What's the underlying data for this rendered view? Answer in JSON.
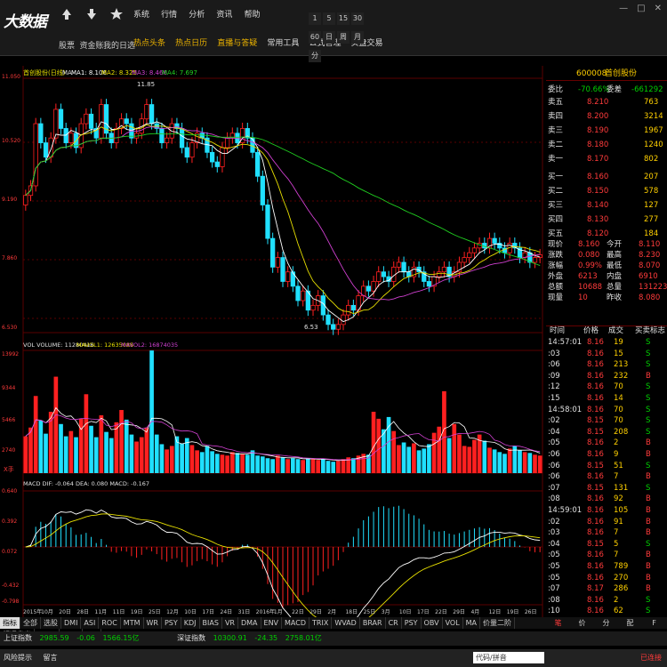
{
  "app": {
    "logo": "大数据"
  },
  "toolbar": [
    {
      "label": "股票",
      "icon": "arrow-up-icon"
    },
    {
      "label": "资金账",
      "icon": "download-icon"
    },
    {
      "label": "我的日选",
      "icon": "star-icon"
    }
  ],
  "menu": [
    "系统",
    "行情",
    "分析",
    "资讯",
    "帮助"
  ],
  "links": [
    "热点头条",
    "热点日历",
    "直播与答疑",
    "常用工具",
    "公式管理",
    "实盘交易"
  ],
  "periods": [
    "1",
    "5",
    "15",
    "30",
    "60",
    "日",
    "周",
    "月",
    "分"
  ],
  "chart": {
    "title": "首创股份(日线)",
    "ma_legend": [
      "MA1: 8.106",
      "MA2: 8.325",
      "MA3: 8.466",
      "MA4: 7.697"
    ],
    "ma_label": "MA",
    "price_ticks": [
      "11.050",
      "10.520",
      "9.190",
      "7.860",
      "6.530"
    ],
    "max_label": "11.85",
    "min_label": "6.53",
    "vol_legend": [
      "VOL VOLUME: 11280416",
      "MAVOL1: 12635088",
      "MAVOL2: 16874035"
    ],
    "vol_ticks": [
      "13992",
      "9344",
      "5466",
      "2740"
    ],
    "vol_unit": "X手",
    "macd_legend": "MACD DIF: -0.064  DEA: 0.080  MACD: -0.167",
    "macd_ticks": [
      "0.640",
      "0.392",
      "0.072",
      "-0.432",
      "-0.798"
    ],
    "dates": [
      "2015年",
      "10月",
      "20日",
      "28日",
      "11月",
      "11日",
      "19日",
      "25日",
      "12月",
      "10日",
      "17日",
      "24日",
      "31日",
      "2016年",
      "1月",
      "22日",
      "29日",
      "2月",
      "18日",
      "25日",
      "3月",
      "10日",
      "17日",
      "22日",
      "29日",
      "4月",
      "12日",
      "19日",
      "26日"
    ],
    "colors": {
      "up": "#ff2020",
      "down": "#20e0ff",
      "ma1": "#ffffff",
      "ma2": "#e8e000",
      "ma3": "#d040d0",
      "ma4": "#20d020"
    }
  },
  "chart_data": {
    "type": "candlestick",
    "ylim": [
      6.53,
      11.85
    ],
    "close": [
      9.4,
      9.6,
      10.9,
      10.5,
      10.2,
      10.6,
      11.2,
      10.8,
      10.5,
      10.7,
      10.4,
      10.9,
      11.1,
      10.8,
      10.6,
      11.3,
      10.7,
      10.5,
      10.8,
      11.0,
      10.9,
      10.6,
      10.7,
      11.0,
      11.3,
      10.9,
      10.8,
      10.5,
      10.6,
      10.9,
      10.8,
      10.4,
      10.2,
      10.5,
      10.7,
      10.6,
      10.3,
      10.1,
      10.0,
      10.4,
      10.6,
      10.7,
      10.5,
      10.8,
      10.6,
      10.3,
      9.8,
      9.2,
      8.5,
      7.9,
      8.1,
      7.6,
      7.8,
      7.5,
      7.2,
      7.4,
      7.0,
      7.1,
      7.3,
      6.9,
      6.7,
      6.6,
      6.7,
      6.9,
      7.1,
      7.0,
      7.3,
      7.5,
      7.4,
      7.6,
      7.8,
      7.7,
      7.6,
      7.9,
      8.0,
      7.8,
      7.7,
      7.9,
      7.8,
      7.6,
      7.5,
      7.7,
      7.8,
      7.9,
      7.7,
      7.8,
      8.0,
      8.1,
      8.2,
      8.3,
      8.4,
      8.3,
      8.5,
      8.4,
      8.3,
      8.2,
      8.4,
      8.3,
      8.1,
      8.2,
      8.0,
      8.1,
      8.16
    ],
    "volume": [
      4200,
      5200,
      8800,
      6000,
      4500,
      7000,
      11000,
      5600,
      4200,
      4800,
      4100,
      6200,
      9000,
      5400,
      4100,
      6600,
      4700,
      4000,
      5800,
      7200,
      6100,
      4400,
      3600,
      4100,
      5200,
      13992,
      4400,
      3300,
      2700,
      3100,
      4200,
      3400,
      4000,
      3200,
      2600,
      2400,
      3100,
      2500,
      2200,
      2100,
      2000,
      2400,
      2300,
      2200,
      2100,
      2600,
      2000,
      1900,
      1700,
      1600,
      2000,
      1800,
      1600,
      1700,
      1600,
      1500,
      1700,
      1600,
      1500,
      1600,
      1400,
      1300,
      1400,
      1600,
      1800,
      1700,
      2000,
      2200,
      2100,
      7000,
      6200,
      5000,
      6400,
      4800,
      3200,
      3500,
      3000,
      3400,
      2600,
      2800,
      3300,
      4600,
      5300,
      9344,
      4000,
      5600,
      4400,
      3100,
      3000,
      3800,
      4400,
      3700,
      2900,
      2700,
      2400,
      2200,
      2800,
      3100,
      2600,
      2400,
      2300,
      2100,
      2000
    ]
  },
  "quote": {
    "code": "600008",
    "name": "首创股份",
    "weibi_label": "委比",
    "weibi": "-70.66%",
    "weicha_label": "委差",
    "weicha": "-661292",
    "sell": [
      [
        "卖五",
        "8.210",
        "763"
      ],
      [
        "卖四",
        "8.200",
        "3214"
      ],
      [
        "卖三",
        "8.190",
        "1967"
      ],
      [
        "卖二",
        "8.180",
        "1240"
      ],
      [
        "卖一",
        "8.170",
        "802"
      ]
    ],
    "buy": [
      [
        "买一",
        "8.160",
        "207"
      ],
      [
        "买二",
        "8.150",
        "578"
      ],
      [
        "买三",
        "8.140",
        "127"
      ],
      [
        "买四",
        "8.130",
        "277"
      ],
      [
        "买五",
        "8.120",
        "184"
      ]
    ],
    "stats": [
      [
        "现价",
        "8.160",
        "今开",
        "8.110"
      ],
      [
        "涨跌",
        "0.080",
        "最高",
        "8.230"
      ],
      [
        "涨幅",
        "0.99%",
        "最低",
        "8.070"
      ],
      [
        "外盘",
        "6213",
        "内盘",
        "6910"
      ],
      [
        "总额",
        "10688",
        "总量",
        "131223"
      ],
      [
        "现量",
        "10",
        "昨收",
        "8.080"
      ]
    ],
    "tick_header": [
      "时间",
      "价格",
      "成交",
      "买卖标志"
    ],
    "ticks": [
      [
        "14:57:01",
        "8.16",
        "19",
        "S"
      ],
      [
        ":03",
        "8.16",
        "15",
        "S"
      ],
      [
        ":06",
        "8.16",
        "213",
        "S"
      ],
      [
        ":09",
        "8.16",
        "232",
        "B"
      ],
      [
        ":12",
        "8.16",
        "70",
        "S"
      ],
      [
        ":15",
        "8.16",
        "14",
        "S"
      ],
      [
        "14:58:01",
        "8.16",
        "70",
        "S"
      ],
      [
        ":02",
        "8.15",
        "70",
        "S"
      ],
      [
        ":04",
        "8.15",
        "208",
        "S"
      ],
      [
        ":05",
        "8.16",
        "2",
        "B"
      ],
      [
        ":06",
        "8.16",
        "9",
        "B"
      ],
      [
        ":06",
        "8.15",
        "51",
        "S"
      ],
      [
        ":06",
        "8.16",
        "7",
        "B"
      ],
      [
        ":07",
        "8.15",
        "131",
        "S"
      ],
      [
        ":08",
        "8.16",
        "92",
        "B"
      ],
      [
        "14:59:01",
        "8.16",
        "105",
        "B"
      ],
      [
        ":02",
        "8.16",
        "91",
        "B"
      ],
      [
        ":03",
        "8.16",
        "7",
        "B"
      ],
      [
        ":04",
        "8.15",
        "5",
        "S"
      ],
      [
        ":05",
        "8.16",
        "7",
        "B"
      ],
      [
        ":05",
        "8.16",
        "789",
        "B"
      ],
      [
        ":05",
        "8.16",
        "270",
        "B"
      ],
      [
        ":07",
        "8.17",
        "286",
        "B"
      ],
      [
        ":08",
        "8.16",
        "2",
        "S"
      ],
      [
        ":10",
        "8.16",
        "62",
        "S"
      ]
    ]
  },
  "tabs": [
    "指标",
    "全部",
    "选股",
    "DMI",
    "ASI",
    "ROC",
    "MTM",
    "WR",
    "PSY",
    "KDJ",
    "BIAS",
    "VR",
    "DMA",
    "ENV",
    "MACD",
    "TRIX",
    "WVAD",
    "BRAR",
    "CR",
    "PSY",
    "OBV",
    "VOL",
    "MA",
    "价量二阶",
    "相通背出",
    "BOLL",
    "MIKE",
    "CCI"
  ],
  "rtabs": [
    "笔",
    "价",
    "分",
    "配",
    "F"
  ],
  "index_bar": [
    {
      "name": "上证指数",
      "value": "2985.59",
      "chg": "-0.06",
      "amt": "1566.15亿"
    },
    {
      "name": "深证指数",
      "value": "10300.91",
      "chg": "-24.35",
      "amt": "2758.01亿"
    }
  ],
  "status": {
    "risk": "风险提示",
    "news": "留言",
    "search_placeholder": "代码/拼音",
    "connected": "已连接"
  }
}
